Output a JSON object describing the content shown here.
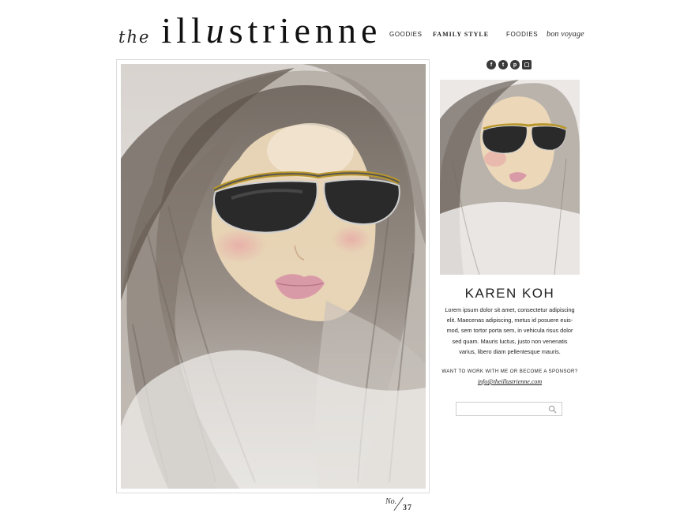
{
  "header": {
    "logo_prefix": "the",
    "logo_part1": "ill",
    "logo_part2": "u",
    "logo_part3": "strienne"
  },
  "nav": {
    "goodies": "GOODIES",
    "family_style": "FAMILY STYLE",
    "foodies": "FOODIES",
    "bon_voyage": "bon voyage"
  },
  "post": {
    "issue_label": "No.",
    "issue_number": "37"
  },
  "sidebar": {
    "social_icons": [
      "facebook-icon",
      "twitter-icon",
      "pinterest-icon",
      "instagram-icon"
    ],
    "author_name": "KAREN KOH",
    "bio": "Lorem ipsum dolor sit amet, consectetur adipiscing elit. Maecenas adipiscing, metus id posuere euis- mod, sem tortor porta sem, in vehicula risus dolor sed quam. Mauris luctus, justo non venenatis varius, libero diam pellentesque mauris.",
    "cta": "WANT TO WORK WITH ME OR BECOME A SPONSOR?",
    "email": "info@theillustrienne.com",
    "search_placeholder": "",
    "search_value": ""
  },
  "colors": {
    "text": "#222222",
    "frame_border": "#dcdcdc",
    "hair": "#6e645c",
    "skin": "#ecd8b8",
    "lens": "#2a2a2a",
    "lip": "#d99aa8",
    "gold": "#b8962c"
  }
}
